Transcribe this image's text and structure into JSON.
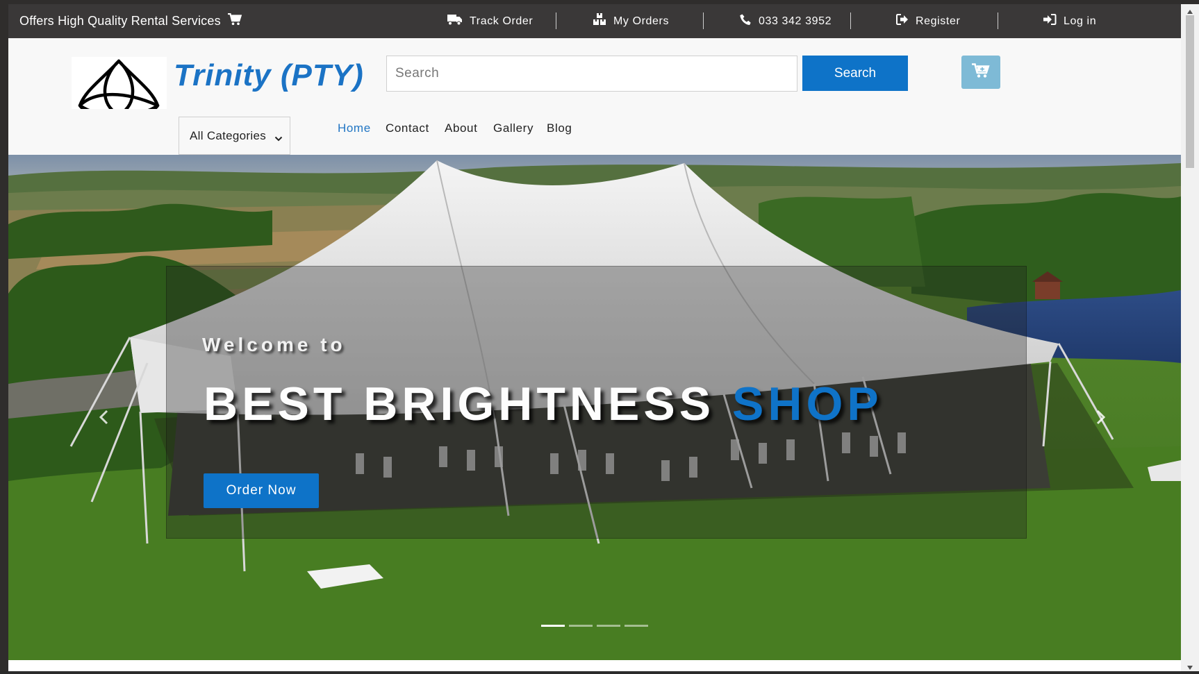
{
  "topbar": {
    "tagline": "Offers High Quality Rental Services",
    "links": [
      {
        "label": "Track Order",
        "icon": "truck-icon"
      },
      {
        "label": "My Orders",
        "icon": "boxes-icon"
      },
      {
        "label": "033 342 3952",
        "icon": "phone-icon"
      },
      {
        "label": "Register",
        "icon": "sign-out-icon"
      },
      {
        "label": "Log in",
        "icon": "sign-in-icon"
      }
    ]
  },
  "header": {
    "brand": "Trinity (PTY)",
    "search": {
      "placeholder": "Search",
      "value": "",
      "button_label": "Search"
    },
    "cart_icon": "cart-icon"
  },
  "nav": {
    "category_select": "All Categories",
    "links": [
      {
        "label": "Home",
        "active": true
      },
      {
        "label": "Contact",
        "active": false
      },
      {
        "label": "About",
        "active": false
      },
      {
        "label": "Gallery",
        "active": false
      },
      {
        "label": "Blog",
        "active": false
      }
    ]
  },
  "hero": {
    "welcome": "Welcome to",
    "headline_main": "BEST BRIGHTNESS",
    "headline_accent": "SHOP",
    "cta_label": "Order Now",
    "slides_total": 4,
    "active_slide": 1
  },
  "colors": {
    "accent": "#0e73c8",
    "topbar_bg": "#3a3838",
    "cart_button": "#7ebad6"
  }
}
